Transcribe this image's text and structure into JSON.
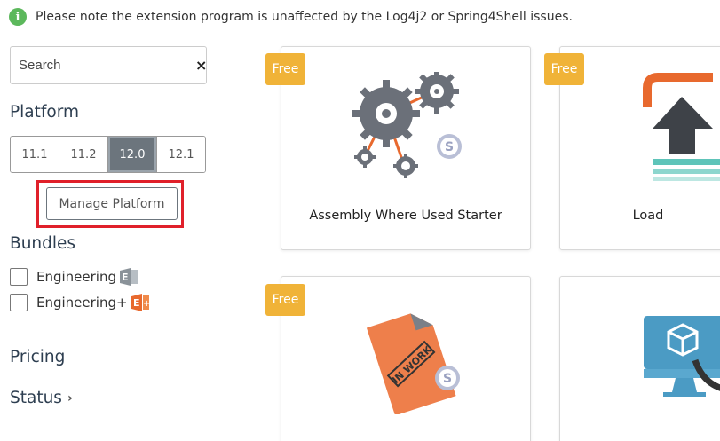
{
  "notice": {
    "icon": "info-circle-icon",
    "text": "Please note the extension program is unaffected by the Log4j2 or Spring4Shell issues."
  },
  "search": {
    "placeholder": "Search",
    "clear_icon": "close-icon",
    "clear_glyph": "×"
  },
  "platform": {
    "heading": "Platform",
    "versions": [
      "11.1",
      "11.2",
      "12.0",
      "12.1"
    ],
    "selected": "12.0",
    "manage_label": "Manage Platform"
  },
  "bundles": {
    "heading": "Bundles",
    "items": [
      {
        "label": "Engineering",
        "checked": false,
        "icon": "engineering-bundle-icon"
      },
      {
        "label": "Engineering+",
        "checked": false,
        "icon": "engineering-plus-bundle-icon"
      }
    ]
  },
  "pricing": {
    "heading": "Pricing"
  },
  "status": {
    "heading": "Status",
    "chevron": "›"
  },
  "cards": [
    {
      "badge": "Free",
      "title": "Assembly Where Used Starter",
      "icon": "gears-icon"
    },
    {
      "badge": "Free",
      "title": "Load",
      "icon": "upload-icon"
    },
    {
      "badge": "Free",
      "title": "",
      "icon": "in-work-document-icon",
      "stamp": "IN WORK"
    },
    {
      "badge": "",
      "title": "",
      "icon": "monitor-cube-icon"
    }
  ],
  "colors": {
    "badge": "#f0b338",
    "highlight": "#e0202a",
    "selected_platform": "#6c757d",
    "info": "#5cb85c"
  }
}
